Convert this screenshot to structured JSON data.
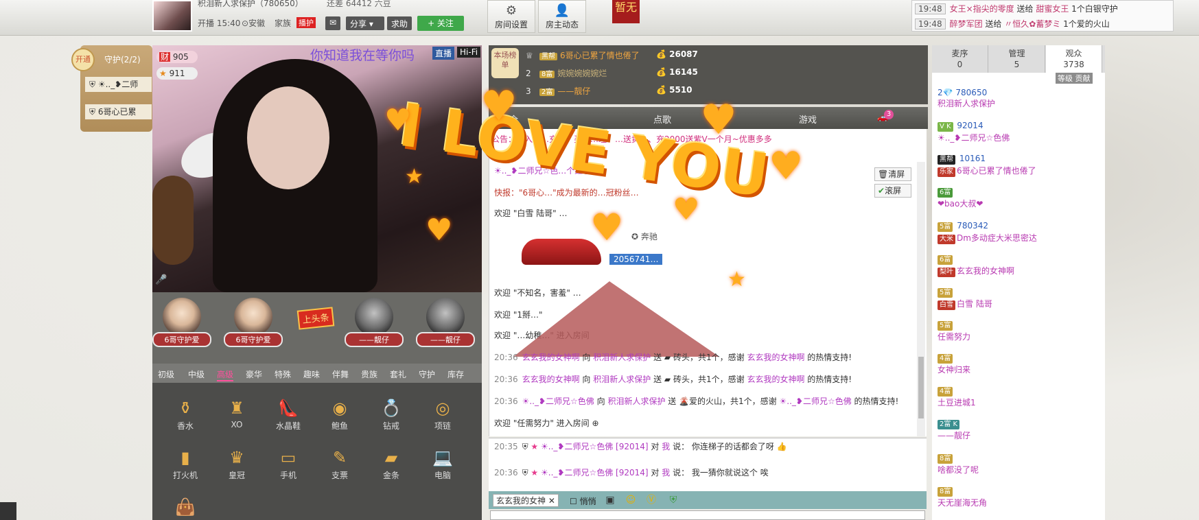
{
  "topbar": {
    "anchor_name": "积泪新人求保护（780650）",
    "live_time": "开播 15:40",
    "security": "安徽",
    "family_tag": "家族",
    "badge": "播护",
    "share": "分享",
    "help": "求助",
    "follow": "+ 关注",
    "love_count": "还差 64412 六豆",
    "room_settings": "房间设置",
    "anchor_news": "房主动态",
    "zanwu": "暂无"
  },
  "news": [
    {
      "time": "19:48",
      "from": "女王×指尖的零度",
      "action": "送给",
      "to": "甜蜜女王",
      "tail": "1个白银守护"
    },
    {
      "time": "19:48",
      "from": "醉梦军团",
      "action": "送给",
      "to": "〃恒久✿蓄梦ミ",
      "tail": "1个爱的火山"
    }
  ],
  "guard": {
    "open_label": "开通",
    "title": "守护(2/2)",
    "items": [
      "☀.._❥二师",
      "6哥心已累"
    ]
  },
  "video": {
    "wealth": "905",
    "stars": "911",
    "scroll": "你知道我在等你吗",
    "live": "直播",
    "hifi": "Hi-Fi"
  },
  "seats": [
    {
      "name": "6哥守护爱"
    },
    {
      "name": "6哥守护爱"
    },
    {
      "name": "——靓仔"
    },
    {
      "name": "——靓仔"
    }
  ],
  "headline": "上头条",
  "gift_tabs": [
    "初级",
    "中级",
    "高级",
    "豪华",
    "特殊",
    "趣味",
    "伴舞",
    "贵族",
    "套礼",
    "守护",
    "库存"
  ],
  "gift_tab_active": "高级",
  "gifts": [
    {
      "name": "香水",
      "icon": "perfume"
    },
    {
      "name": "XO",
      "icon": "bottle"
    },
    {
      "name": "水晶鞋",
      "icon": "heel"
    },
    {
      "name": "鲍鱼",
      "icon": "abalone"
    },
    {
      "name": "钻戒",
      "icon": "ring"
    },
    {
      "name": "项链",
      "icon": "necklace"
    },
    {
      "name": "打火机",
      "icon": "lighter"
    },
    {
      "name": "皇冠",
      "icon": "crown"
    },
    {
      "name": "手机",
      "icon": "phone"
    },
    {
      "name": "支票",
      "icon": "cheque"
    },
    {
      "name": "金条",
      "icon": "gold"
    },
    {
      "name": "电脑",
      "icon": "laptop"
    },
    {
      "name": "",
      "icon": "bag"
    }
  ],
  "rank": {
    "label": "本场榜单",
    "rows": [
      {
        "n": "",
        "lv": "黑帮",
        "name": "6哥心已累了情也倦了",
        "pts": "26087"
      },
      {
        "n": "2",
        "lv": "8富",
        "name": "婉婉婉婉婉烂",
        "pts": "16145"
      },
      {
        "n": "3",
        "lv": "2富",
        "name": "——靓仔",
        "pts": "5510"
      }
    ]
  },
  "chat_tabs": [
    "全",
    "点歌",
    "游戏"
  ],
  "car_badge": "3",
  "chat": {
    "notice": "公告：…入求…充值、买续…理！…送黄…、充2000送紫V一个月~优惠多多",
    "clear": "清屏",
    "scroll": "滚屏",
    "redpack": "☀.._❥二师兄☆色…个红包",
    "express": "快报：\"6哥心…\"成为最新的…冠粉丝…",
    "welcome1": "欢迎 \"白雪 陆哥\" …",
    "car_name": "奔驰",
    "car_id": "2056741…",
    "welcome2": "欢迎 \"不知名，害羞\" …",
    "welcome3": "欢迎 \"1掰…\"",
    "welcome4": "欢迎 \"…幼稚…\" 进入房间",
    "gift_lines": [
      {
        "time": "20:36",
        "from": "玄玄我的女神啊",
        "to": "积泪新人求保护",
        "gift": "砖头，共1个，感谢",
        "thank": "玄玄我的女神啊",
        "tail": "的热情支持!"
      },
      {
        "time": "20:36",
        "from": "玄玄我的女神啊",
        "to": "积泪新人求保护",
        "gift": "砖头，共1个，感谢",
        "thank": "玄玄我的女神啊",
        "tail": "的热情支持!"
      },
      {
        "time": "20:36",
        "from": "☀.._❥二师兄☆色佛",
        "to": "积泪新人求保护",
        "gift": "爱的火山，共1个，感谢",
        "thank": "☀.._❥二师兄☆色佛",
        "tail": "的热情支持!"
      }
    ],
    "welcome5": "欢迎 \"任需努力\" 进入房间"
  },
  "private": [
    {
      "time": "20:35",
      "name": "☀.._❥二师兄☆色佛",
      "id": "[92014]",
      "to": "我",
      "msg": "你连梯子的话都会了呀"
    },
    {
      "time": "20:36",
      "name": "☀.._❥二师兄☆色佛",
      "id": "[92014]",
      "to": "我",
      "msg": "我一猜你就说这个 唉"
    }
  ],
  "input": {
    "target": "玄玄我的女神",
    "whisper": "悄悄"
  },
  "user_tabs": [
    {
      "label": "麦序",
      "count": "0"
    },
    {
      "label": "管理",
      "count": "5"
    },
    {
      "label": "观众",
      "count": "3738"
    }
  ],
  "contrib": "等级 贡献",
  "users": [
    {
      "badge": "2",
      "id": "780650",
      "name": "积泪新人求保护"
    },
    {
      "badge": "V K",
      "id": "92014",
      "name": "☀.._❥二师兄☆色佛"
    },
    {
      "badge": "黑帮",
      "id": "10161",
      "name": "6哥心已累了情也倦了",
      "tag": "乐家"
    },
    {
      "badge": "6富",
      "id": "",
      "name": "❤bao大叔❤"
    },
    {
      "badge": "5富",
      "id": "780342",
      "name": "Dm多动症大米思密达",
      "tag": "大米"
    },
    {
      "badge": "6富",
      "id": "",
      "name": "玄玄我的女神啊",
      "tag": "梨叶"
    },
    {
      "badge": "5富",
      "id": "",
      "name": "白雪 陆哥",
      "tag": "白雪"
    },
    {
      "badge": "5富",
      "id": "",
      "name": "任需努力"
    },
    {
      "badge": "4富",
      "id": "",
      "name": "女神归来"
    },
    {
      "badge": "4富",
      "id": "",
      "name": "土豆进城1"
    },
    {
      "badge": "2富 K",
      "id": "",
      "name": "——靓仔"
    },
    {
      "badge": "8富",
      "id": "",
      "name": "啥都没了呢"
    },
    {
      "badge": "8富",
      "id": "",
      "name": "天无崖海无角"
    }
  ],
  "overlay": {
    "text": "I LOVE YOU"
  },
  "colors": {
    "accent": "#ff4f9c",
    "follow": "#3fa84a",
    "rank_bg": "#54534f"
  }
}
